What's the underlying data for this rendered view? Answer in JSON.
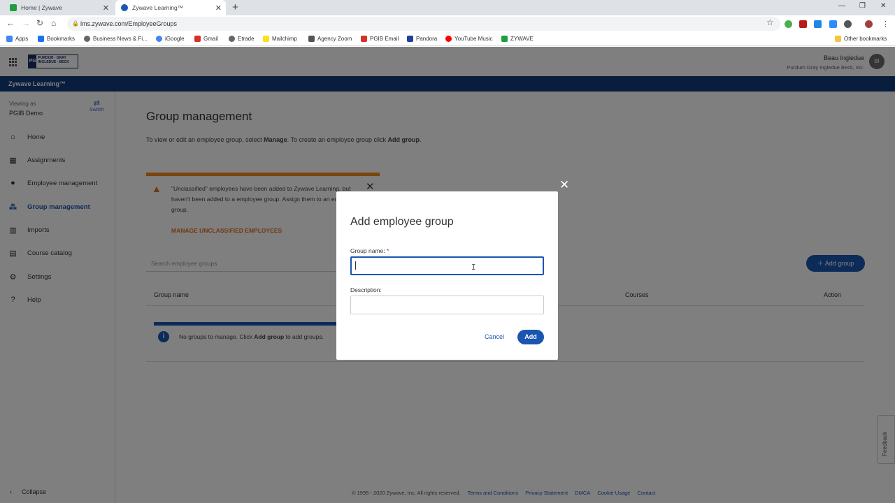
{
  "browser": {
    "tabs": [
      {
        "title": "Home | Zywave",
        "favicon_color": "#1f9d3f"
      },
      {
        "title": "Zywave Learning™",
        "favicon_color": "#1a56b0"
      }
    ],
    "url": "lms.zywave.com/EmployeeGroups",
    "bookmarks": [
      {
        "label": "Apps",
        "icon": "apps-grid-icon"
      },
      {
        "label": "Bookmarks",
        "icon": "star-icon"
      },
      {
        "label": "Business News & Fi...",
        "icon": "globe-icon"
      },
      {
        "label": "iGoogle",
        "icon": "google-icon"
      },
      {
        "label": "Gmail",
        "icon": "gmail-icon"
      },
      {
        "label": "Etrade",
        "icon": "globe-icon"
      },
      {
        "label": "Mailchimp",
        "icon": "mailchimp-icon"
      },
      {
        "label": "Agency Zoom",
        "icon": "agencyzoom-icon"
      },
      {
        "label": "PGIB Email",
        "icon": "gmail-icon"
      },
      {
        "label": "Pandora",
        "icon": "pandora-icon"
      },
      {
        "label": "YouTube Music",
        "icon": "youtube-music-icon"
      },
      {
        "label": "ZYWAVE",
        "icon": "zywave-icon"
      }
    ],
    "other_bookmarks": "Other bookmarks"
  },
  "header": {
    "logo_mark": "PG IB",
    "logo_text": "PURDUM · GRAY INGLEDUE · BECK",
    "user_name": "Beau Ingledue",
    "user_org": "Purdum Gray Ingledue Beck, Inc.",
    "avatar_initials": "BI",
    "product_name": "Zywave Learning™"
  },
  "sidebar": {
    "viewing_label": "Viewing as",
    "viewing_value": "PGIB Demo",
    "switch_label": "Switch",
    "items": [
      {
        "label": "Home",
        "icon": "home-icon"
      },
      {
        "label": "Assignments",
        "icon": "calendar-icon"
      },
      {
        "label": "Employee management",
        "icon": "person-icon"
      },
      {
        "label": "Group management",
        "icon": "group-icon"
      },
      {
        "label": "Imports",
        "icon": "imports-icon"
      },
      {
        "label": "Course catalog",
        "icon": "catalog-icon"
      },
      {
        "label": "Settings",
        "icon": "gear-icon"
      },
      {
        "label": "Help",
        "icon": "help-icon"
      }
    ],
    "active_index": 3,
    "collapse_label": "Collapse"
  },
  "main": {
    "title": "Group management",
    "description_pre": "To view or edit an employee group, select ",
    "description_manage": "Manage",
    "description_mid": ". To create an employee group click ",
    "description_add": "Add group",
    "description_end": ".",
    "alert_text": "\"Unclassified\" employees have been added to Zywave Learning, but haven't been added to a employee group. Assign them to an employee group.",
    "alert_link": "MANAGE UNCLASSIFIED EMPLOYEES",
    "search_placeholder": "Search employee groups",
    "add_group_label": "Add group",
    "columns": [
      "Group name",
      "Courses",
      "Action"
    ],
    "empty_pre": "No groups to manage. Click ",
    "empty_bold": "Add group",
    "empty_post": " to add groups."
  },
  "footer": {
    "copyright": "© 1995 - 2020 Zywave, Inc. All rights reserved.",
    "links": [
      "Terms and Conditions",
      "Privacy Statement",
      "DMCA",
      "Cookie Usage",
      "Contact"
    ]
  },
  "feedback_label": "Feedback",
  "modal": {
    "title": "Add employee group",
    "group_name_label": "Group name:",
    "required_mark": "*",
    "group_name_value": "",
    "description_label": "Description:",
    "description_value": "",
    "cancel_label": "Cancel",
    "add_label": "Add"
  },
  "colors": {
    "brand_blue": "#123d7a",
    "primary_button": "#1a56b0",
    "alert_orange": "#f28a1e"
  }
}
